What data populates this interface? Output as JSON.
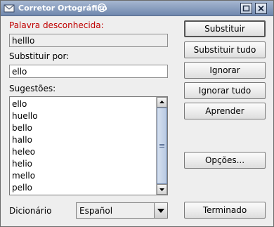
{
  "window": {
    "title": "Corretor Ortográfico"
  },
  "unknown_word": {
    "label": "Palavra desconhecida:",
    "value": "helllo"
  },
  "replace": {
    "label": "Substituir por:",
    "value": "ello"
  },
  "suggestions": {
    "label": "Sugestões:",
    "items": [
      "ello",
      "huello",
      "bello",
      "hallo",
      "heleo",
      "helio",
      "mello",
      "pello"
    ]
  },
  "dictionary": {
    "label": "Dicionário",
    "selected": "Español"
  },
  "buttons": {
    "replace": "Substituir",
    "replace_all": "Substituir tudo",
    "ignore": "Ignorar",
    "ignore_all": "Ignorar tudo",
    "learn": "Aprender",
    "options": "Opções...",
    "done": "Terminado"
  },
  "colors": {
    "title_bar": "#7b92b7",
    "error_label": "#c00000",
    "window_bg": "#eeeeee"
  }
}
